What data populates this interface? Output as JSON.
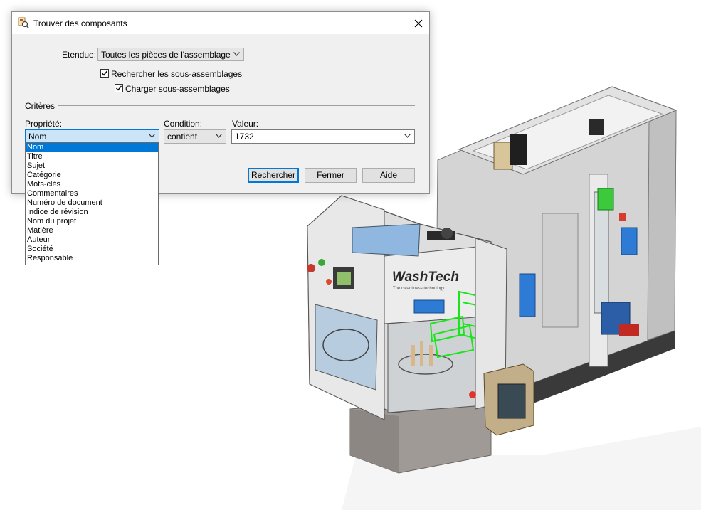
{
  "window": {
    "title": "Trouver des composants",
    "close_glyph": "✕"
  },
  "form": {
    "scope_label": "Etendue:",
    "scope_value": "Toutes les pièces de l'assemblage",
    "search_subassemblies_label": "Rechercher les sous-assemblages",
    "search_subassemblies_checked": true,
    "load_subassemblies_label": "Charger sous-assemblages",
    "load_subassemblies_checked": true,
    "criteria_label": "Critères",
    "property_label": "Propriété:",
    "property_value": "Nom",
    "condition_label": "Condition:",
    "condition_value": "contient",
    "value_label": "Valeur:",
    "value_value": "1732"
  },
  "buttons": {
    "search": "Rechercher",
    "close": "Fermer",
    "help": "Aide"
  },
  "property_options": [
    "Nom",
    "Titre",
    "Sujet",
    "Catégorie",
    "Mots-clés",
    "Commentaires",
    "Numéro de document",
    "Indice de révision",
    "Nom du projet",
    "Matière",
    "Auteur",
    "Société",
    "Responsable"
  ],
  "property_selected_index": 0,
  "model": {
    "logo_text": "WashTech",
    "logo_tagline": "The cleanliness technology"
  },
  "colors": {
    "accent": "#0078d7",
    "highlight_green": "#19e619",
    "machine_grey": "#c9c9c9",
    "panel_blue": "#8fb7e0"
  },
  "icons": {
    "app": "find-components-icon",
    "close": "close-icon",
    "dropdown": "chevron-down-icon",
    "check": "checkmark-icon"
  }
}
